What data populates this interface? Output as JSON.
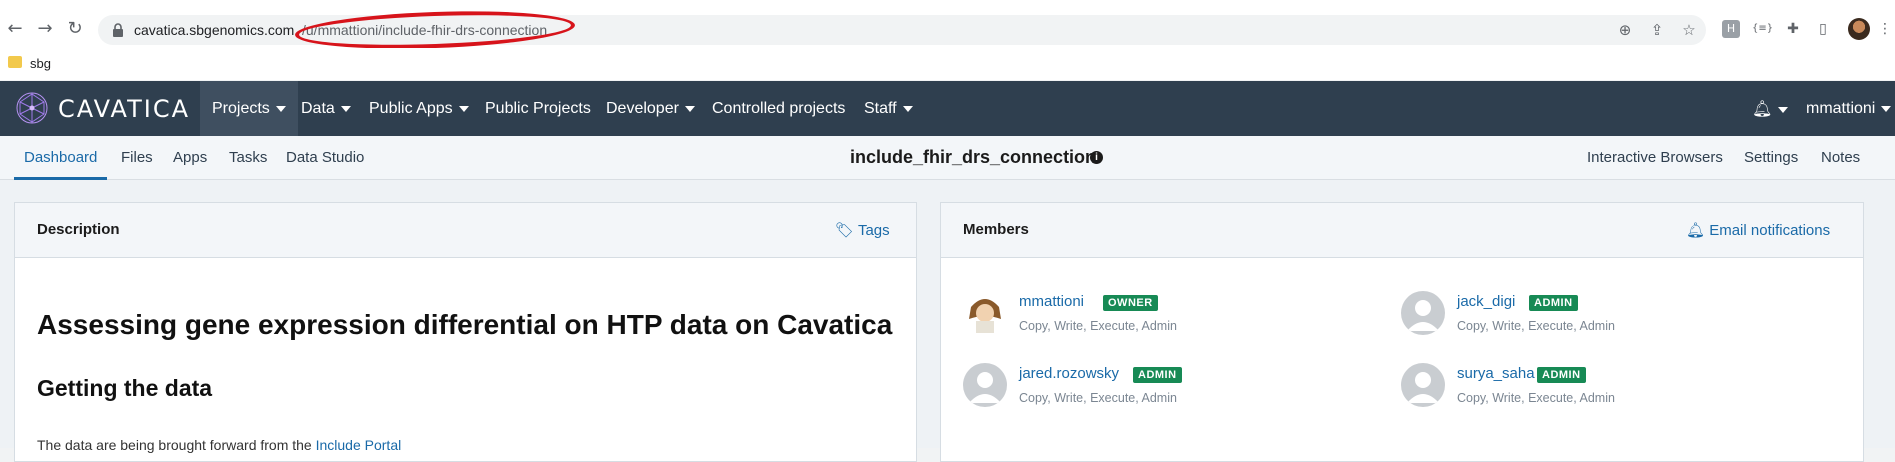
{
  "browser": {
    "url_host": "cavatica.sbgenomics.com",
    "url_path": "/u/mmattioni/include-fhir-drs-connection",
    "bookmark": "sbg"
  },
  "nav": {
    "logo_text": "CAVATICA",
    "items": [
      "Projects",
      "Data",
      "Public Apps",
      "Public Projects",
      "Developer",
      "Controlled projects",
      "Staff"
    ],
    "user": "mmattioni"
  },
  "subnav": {
    "tabs": [
      "Dashboard",
      "Files",
      "Apps",
      "Tasks",
      "Data Studio"
    ],
    "project_title": "include_fhir_drs_connection",
    "right_links": [
      "Interactive Browsers",
      "Settings",
      "Notes"
    ]
  },
  "description": {
    "title": "Description",
    "tags_label": "Tags",
    "heading": "Assessing gene expression differential on HTP data on Cavatica",
    "subheading": "Getting the data",
    "paragraph_prefix": "The data are being brought forward from the ",
    "paragraph_link": "Include Portal"
  },
  "members": {
    "title": "Members",
    "email_label": "Email notifications",
    "list": [
      {
        "name": "mmattioni",
        "role": "OWNER",
        "perms": "Copy, Write, Execute, Admin"
      },
      {
        "name": "jack_digi",
        "role": "ADMIN",
        "perms": "Copy, Write, Execute, Admin"
      },
      {
        "name": "jared.rozowsky",
        "role": "ADMIN",
        "perms": "Copy, Write, Execute, Admin"
      },
      {
        "name": "surya_saha",
        "role": "ADMIN",
        "perms": "Copy, Write, Execute, Admin"
      }
    ]
  },
  "colors": {
    "navbar": "#2f3f4f",
    "link": "#1a6aa8",
    "badge": "#178a55",
    "annotation": "#d7141b"
  }
}
